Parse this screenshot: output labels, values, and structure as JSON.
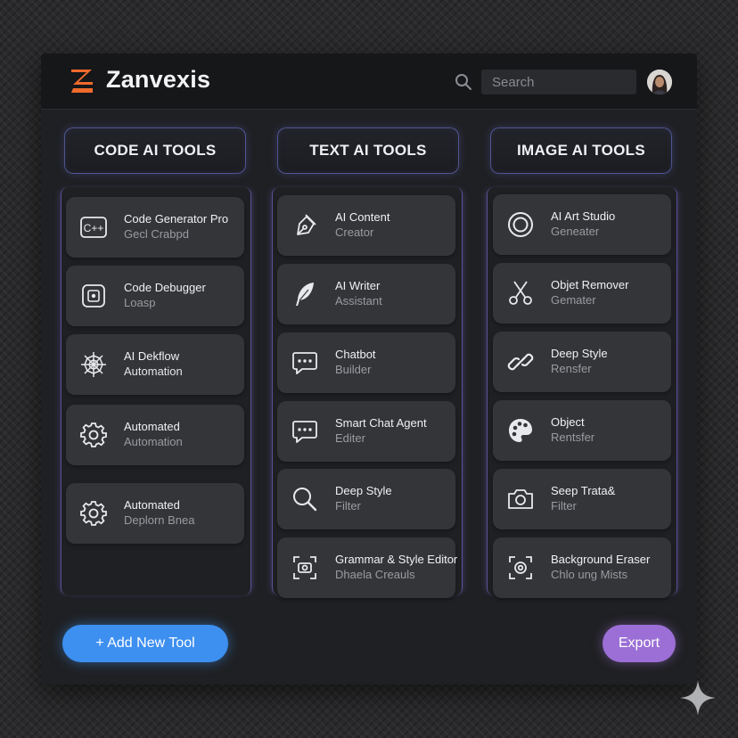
{
  "header": {
    "brand": "Zanvexis",
    "search_placeholder": "Search"
  },
  "columns": [
    {
      "title": "CODE AI TOOLS",
      "tools": [
        {
          "title": "Code Generator Pro",
          "subtitle": "Gecl Crabpd",
          "icon": "cpp-icon"
        },
        {
          "title": "Code Debugger",
          "subtitle": "Loasp",
          "icon": "debug-icon"
        },
        {
          "title": "AI Dekflow",
          "subtitle": "Automation",
          "icon": "web-icon"
        },
        {
          "title": "Automated",
          "subtitle": "Automation",
          "icon": "gear-icon"
        },
        {
          "title": "Automated",
          "subtitle": "Deplorn Bnea",
          "icon": "gear-icon"
        }
      ]
    },
    {
      "title": "TEXT AI TOOLS",
      "tools": [
        {
          "title": "AI Content",
          "subtitle": "Creator",
          "icon": "pen-nib-icon"
        },
        {
          "title": "AI Writer",
          "subtitle": "Assistant",
          "icon": "feather-icon"
        },
        {
          "title": "Chatbot",
          "subtitle": "Builder",
          "icon": "chat-icon"
        },
        {
          "title": "Smart Chat Agent",
          "subtitle": "Editer",
          "icon": "chat-icon"
        },
        {
          "title": "Deep Style",
          "subtitle": "Filter",
          "icon": "magnifier-icon"
        },
        {
          "title": "Grammar & Style Editor",
          "subtitle": "Dhaela Creauls",
          "icon": "scan-icon"
        }
      ]
    },
    {
      "title": "IMAGE AI TOOLS",
      "tools": [
        {
          "title": "AI Art Studio",
          "subtitle": "Geneater",
          "icon": "circle-icon"
        },
        {
          "title": "Objet Remover",
          "subtitle": "Gemater",
          "icon": "scissors-icon"
        },
        {
          "title": "Deep Style",
          "subtitle": "Rensfer",
          "icon": "link-icon"
        },
        {
          "title": "Object",
          "subtitle": "Rentsfer",
          "icon": "palette-icon"
        },
        {
          "title": "Seep Trata&",
          "subtitle": "Filter",
          "icon": "camera-icon"
        },
        {
          "title": "Background Eraser",
          "subtitle": "Chlo ung Mists",
          "icon": "focus-camera-icon"
        }
      ]
    }
  ],
  "actions": {
    "add_label": "+ Add New Tool",
    "export_label": "Export"
  },
  "colors": {
    "accent_blue": "#3d8ff0",
    "accent_purple": "#9b6fd6",
    "logo_orange": "#f06a2c",
    "glow": "#7c82ea"
  }
}
